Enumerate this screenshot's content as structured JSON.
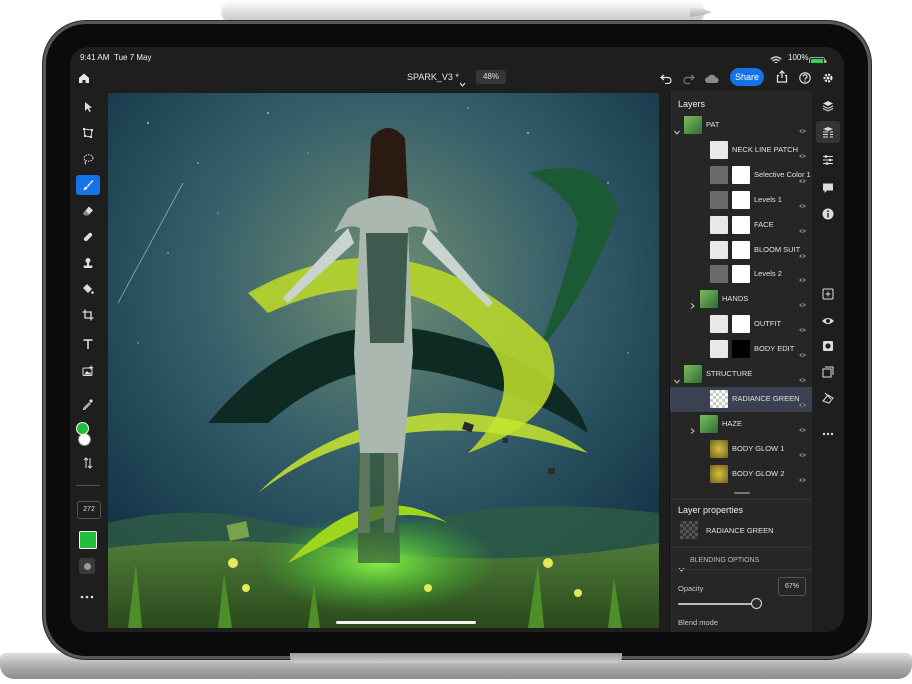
{
  "status_bar": {
    "time": "9:41 AM",
    "date": "Tue 7 May",
    "battery": "100%"
  },
  "header": {
    "document_title": "SPARK_V3 *",
    "zoom": "48%",
    "share_label": "Share"
  },
  "toolbar": {
    "brush_size": "272"
  },
  "colors": {
    "accent": "#1473e6",
    "foreground_color": "#22c03a",
    "background_color": "#ffffff",
    "selected_row": "#3a4150"
  },
  "layers_panel": {
    "title": "Layers",
    "layers": [
      {
        "name": "PAT",
        "type": "group",
        "expanded": true,
        "indent": 0
      },
      {
        "name": "NECK LINE PATCH",
        "type": "layer",
        "indent": 1
      },
      {
        "name": "Selective Color 1",
        "type": "adjustment",
        "indent": 1
      },
      {
        "name": "Levels 1",
        "type": "adjustment",
        "indent": 1
      },
      {
        "name": "FACE",
        "type": "masked",
        "indent": 1
      },
      {
        "name": "BLOOM SUIT",
        "type": "masked",
        "indent": 1
      },
      {
        "name": "Levels 2",
        "type": "adjustment",
        "indent": 1
      },
      {
        "name": "HANDS",
        "type": "group",
        "expanded": false,
        "indent": 1
      },
      {
        "name": "OUTFIT",
        "type": "masked",
        "indent": 1
      },
      {
        "name": "BODY EDIT",
        "type": "masked",
        "indent": 1
      },
      {
        "name": "STRUCTURE",
        "type": "group",
        "expanded": true,
        "indent": 0
      },
      {
        "name": "RADIANCE GREEN",
        "type": "layer",
        "indent": 1,
        "selected": true
      },
      {
        "name": "HAZE",
        "type": "group",
        "expanded": false,
        "indent": 1
      },
      {
        "name": "BODY GLOW 1",
        "type": "layer",
        "indent": 1
      },
      {
        "name": "BODY GLOW 2",
        "type": "layer",
        "indent": 1
      }
    ]
  },
  "layer_properties": {
    "title": "Layer properties",
    "layer_name": "RADIANCE GREEN",
    "blending_options_label": "BLENDING OPTIONS",
    "opacity_label": "Opacity",
    "opacity_value": "67%",
    "opacity_fraction": 0.67,
    "blend_mode_label": "Blend mode"
  }
}
